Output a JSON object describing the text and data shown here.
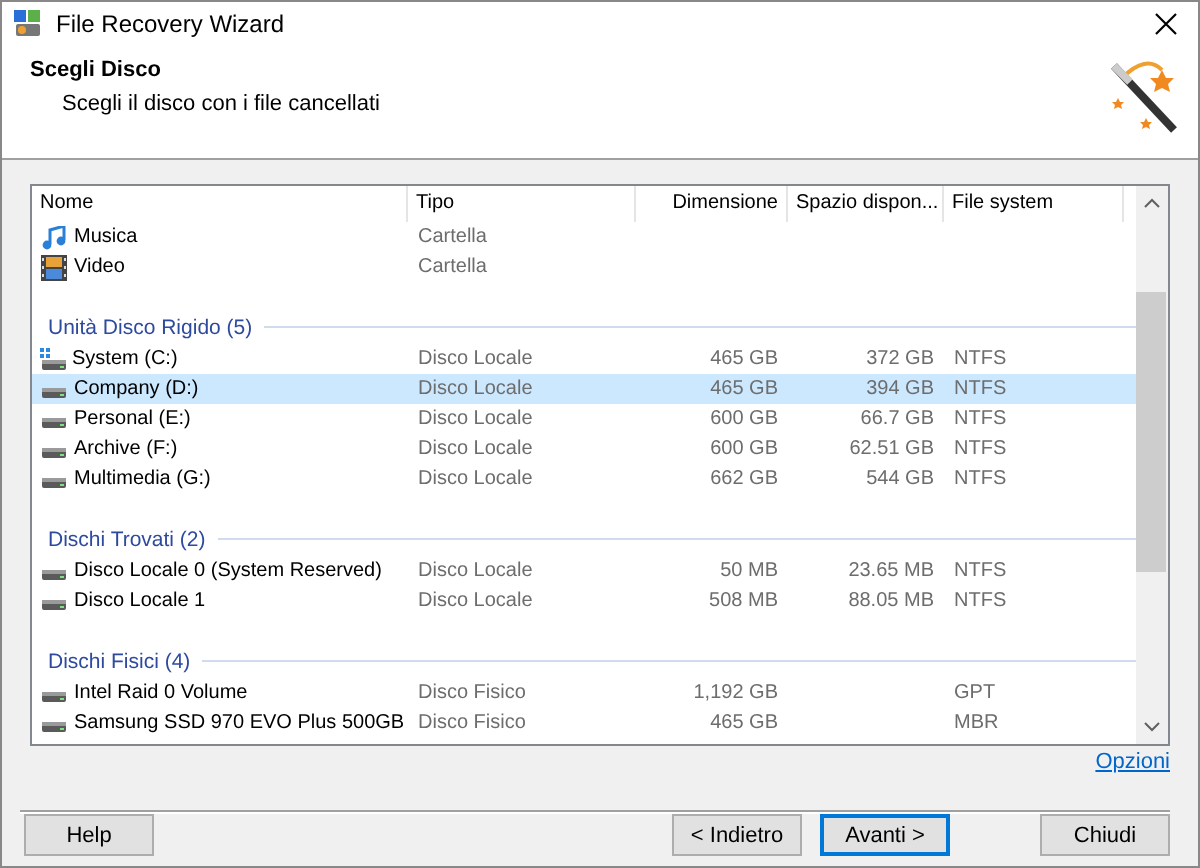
{
  "window": {
    "title": "File Recovery Wizard"
  },
  "header": {
    "title": "Scegli Disco",
    "subtitle": "Scegli il disco con i file cancellati"
  },
  "table": {
    "columns": [
      "Nome",
      "Tipo",
      "Dimensione",
      "Spazio dispon...",
      "File system"
    ],
    "groups": [
      {
        "rows": [
          {
            "kind": "music",
            "name": "Musica",
            "type": "Cartella",
            "selected": false
          },
          {
            "kind": "video",
            "name": "Video",
            "type": "Cartella",
            "selected": false
          }
        ]
      },
      {
        "title": "Unità Disco Rigido (5)",
        "rows": [
          {
            "kind": "system-drive",
            "name": "System (C:)",
            "type": "Disco Locale",
            "size": "465 GB",
            "free": "372 GB",
            "fs": "NTFS",
            "selected": false
          },
          {
            "kind": "drive",
            "name": "Company (D:)",
            "type": "Disco Locale",
            "size": "465 GB",
            "free": "394 GB",
            "fs": "NTFS",
            "selected": true
          },
          {
            "kind": "drive",
            "name": "Personal (E:)",
            "type": "Disco Locale",
            "size": "600 GB",
            "free": "66.7 GB",
            "fs": "NTFS",
            "selected": false
          },
          {
            "kind": "drive",
            "name": "Archive (F:)",
            "type": "Disco Locale",
            "size": "600 GB",
            "free": "62.51 GB",
            "fs": "NTFS",
            "selected": false
          },
          {
            "kind": "drive",
            "name": "Multimedia (G:)",
            "type": "Disco Locale",
            "size": "662 GB",
            "free": "544 GB",
            "fs": "NTFS",
            "selected": false
          }
        ]
      },
      {
        "title": "Dischi Trovati (2)",
        "rows": [
          {
            "kind": "drive",
            "name": "Disco Locale 0 (System Reserved)",
            "type": "Disco Locale",
            "size": "50 MB",
            "free": "23.65 MB",
            "fs": "NTFS",
            "selected": false
          },
          {
            "kind": "drive",
            "name": "Disco Locale 1",
            "type": "Disco Locale",
            "size": "508 MB",
            "free": "88.05 MB",
            "fs": "NTFS",
            "selected": false
          }
        ]
      },
      {
        "title": "Dischi Fisici (4)",
        "rows": [
          {
            "kind": "drive",
            "name": "Intel Raid 0 Volume",
            "type": "Disco Fisico",
            "size": "1,192 GB",
            "fs": "GPT",
            "selected": false
          },
          {
            "kind": "drive",
            "name": "Samsung SSD 970 EVO Plus 500GB",
            "type": "Disco Fisico",
            "size": "465 GB",
            "fs": "MBR",
            "selected": false
          }
        ]
      }
    ]
  },
  "options_link": "Opzioni",
  "buttons": [
    {
      "label": "Help",
      "kind": "left",
      "default": false
    },
    {
      "label": "< Indietro",
      "kind": "right",
      "default": false
    },
    {
      "label": "Avanti >",
      "kind": "right",
      "default": true
    },
    {
      "label": "Chiudi",
      "kind": "far",
      "default": false
    }
  ]
}
